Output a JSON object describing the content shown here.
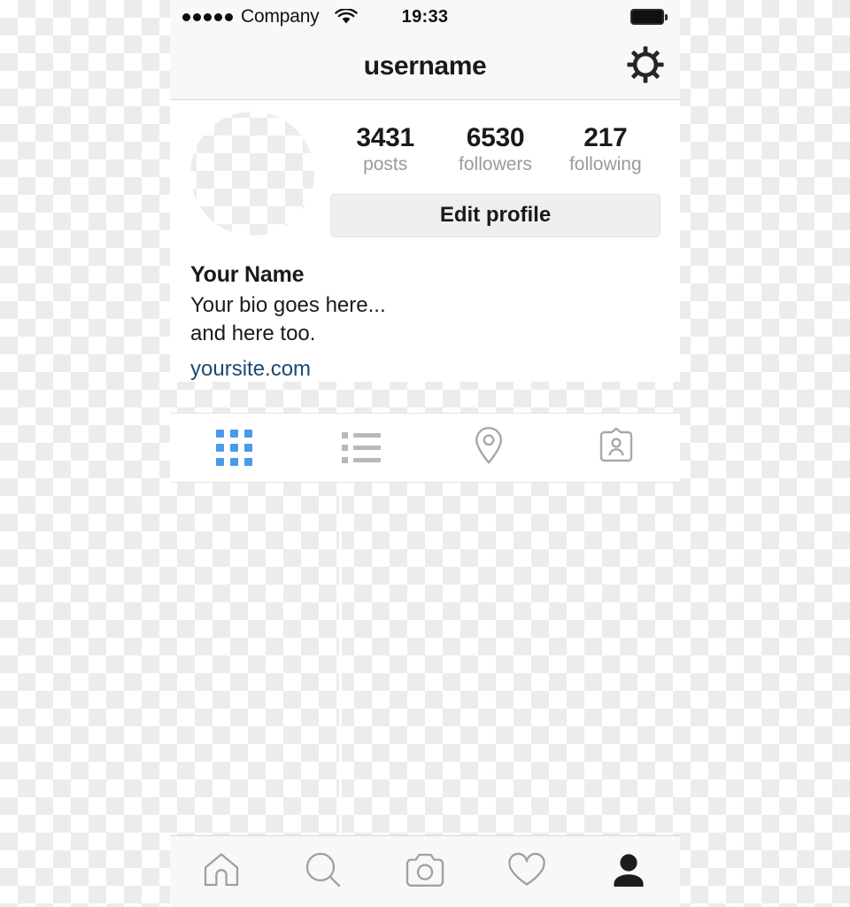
{
  "status_bar": {
    "signal_dots": 5,
    "carrier": "Company",
    "wifi_icon": "wifi-icon",
    "time": "19:33",
    "battery_icon": "battery-full-icon"
  },
  "header": {
    "title": "username",
    "settings_icon": "gear-icon"
  },
  "profile": {
    "avatar_icon": "avatar-placeholder",
    "stats": [
      {
        "value": "3431",
        "label": "posts",
        "name": "posts"
      },
      {
        "value": "6530",
        "label": "followers",
        "name": "followers"
      },
      {
        "value": "217",
        "label": "following",
        "name": "following"
      }
    ],
    "edit_button": "Edit profile",
    "name": "Your Name",
    "bio_line_1": "Your bio goes here...",
    "bio_line_2": "and here too.",
    "website": "yoursite.com"
  },
  "content_tabs": [
    {
      "name": "grid-view",
      "icon": "grid-icon",
      "active": true
    },
    {
      "name": "list-view",
      "icon": "list-icon",
      "active": false
    },
    {
      "name": "photo-map",
      "icon": "location-pin-icon",
      "active": false
    },
    {
      "name": "photos-of-you",
      "icon": "tagged-card-icon",
      "active": false
    }
  ],
  "tab_bar": [
    {
      "name": "home",
      "icon": "home-icon",
      "active": false
    },
    {
      "name": "search",
      "icon": "search-icon",
      "active": false
    },
    {
      "name": "camera",
      "icon": "camera-icon",
      "active": false
    },
    {
      "name": "activity",
      "icon": "heart-icon",
      "active": false
    },
    {
      "name": "profile",
      "icon": "person-icon",
      "active": true
    }
  ],
  "colors": {
    "accent_blue": "#4a9ae8",
    "link_blue": "#1c4b72",
    "icon_gray": "#9a9a9a",
    "text_dark": "#1a1a1a",
    "header_bg": "#f8f8f8",
    "button_bg": "#efefef"
  }
}
